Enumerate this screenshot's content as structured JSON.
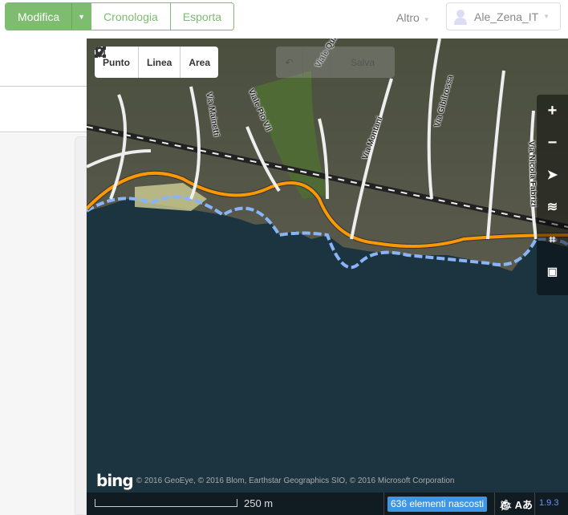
{
  "topbar": {
    "mode_buttons": [
      {
        "label": "Modifica",
        "active": true
      },
      {
        "label": "Cronologia"
      },
      {
        "label": "Esporta"
      }
    ],
    "more_label": "Altro",
    "user_name": "Ale_Zena_IT"
  },
  "map": {
    "draw_tools": [
      {
        "label": "Punto",
        "icon": "pin-icon"
      },
      {
        "label": "Linea",
        "icon": "line-icon"
      },
      {
        "label": "Area",
        "icon": "area-icon"
      }
    ],
    "undo_icon": "undo-icon",
    "save_label": "Salva",
    "controls": [
      "zoom-in-icon",
      "zoom-out-icon",
      "geolocate-icon",
      "layers-icon",
      "map-data-icon",
      "help-icon"
    ],
    "street_labels": [
      "Via Mainetti",
      "Viale Pio VII",
      "Viale Quarara",
      "Via Montani",
      "Via Gibilrossa",
      "Via Nicola Fabrizi"
    ],
    "imagery_logo": "bing",
    "attribution": "© 2016 GeoEye, © 2016 Blom, Earthstar Geographics SIO, © 2016 Microsoft Corporation"
  },
  "footer": {
    "scale_label": "250 m",
    "hidden_features": "636 elementi nascosti",
    "version": "1.9.3"
  },
  "colors": {
    "accent": "#7ebc6f",
    "badge": "#3e97e6",
    "road_primary": "#f99806",
    "sea": "#1c3440"
  }
}
